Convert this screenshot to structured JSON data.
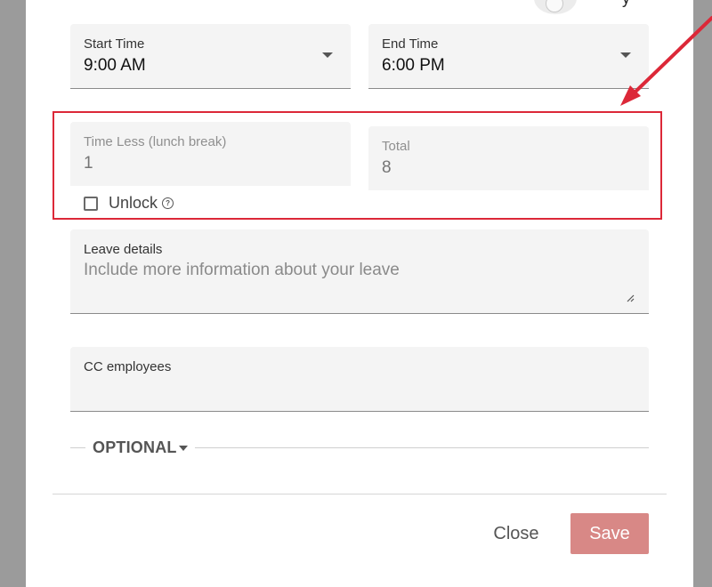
{
  "header": {
    "toggle_label_tail": "y"
  },
  "time": {
    "start": {
      "label": "Start Time",
      "value": "9:00 AM"
    },
    "end": {
      "label": "End Time",
      "value": "6:00 PM"
    }
  },
  "break": {
    "time_less": {
      "label": "Time Less (lunch break)",
      "value": "1"
    },
    "total": {
      "label": "Total",
      "value": "8"
    },
    "unlock_label": "Unlock",
    "help_glyph": "?"
  },
  "leave_details": {
    "label": "Leave details",
    "placeholder": "Include more information about your leave"
  },
  "cc": {
    "label": "CC employees"
  },
  "optional": {
    "label": "OPTIONAL"
  },
  "footer": {
    "close_label": "Close",
    "save_label": "Save"
  },
  "colors": {
    "annotation_red": "#dc2838",
    "save_button": "#d88886"
  },
  "icons": [
    "dropdown-arrow-icon",
    "help-icon",
    "resize-handle-icon",
    "caret-down-icon",
    "annotation-arrow-icon"
  ]
}
